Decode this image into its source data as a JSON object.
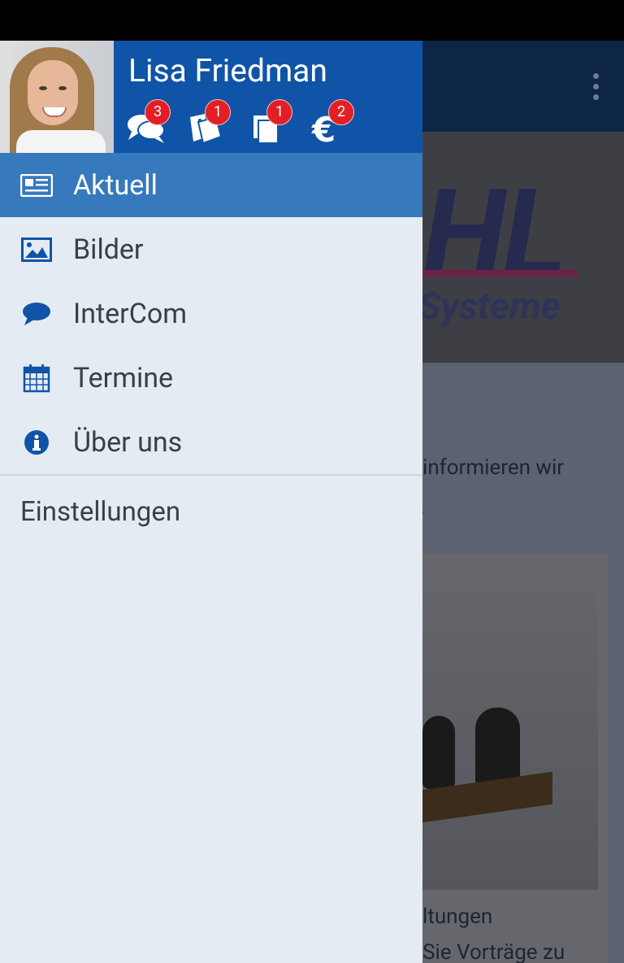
{
  "user": {
    "name": "Lisa Friedman"
  },
  "header_icons": [
    {
      "name": "chat-icon",
      "badge": "3"
    },
    {
      "name": "tickets-icon",
      "badge": "1"
    },
    {
      "name": "documents-icon",
      "badge": "1"
    },
    {
      "name": "euro-icon",
      "badge": "2"
    }
  ],
  "menu": {
    "items": [
      {
        "label": "Aktuell",
        "icon": "newspaper-icon",
        "active": true
      },
      {
        "label": "Bilder",
        "icon": "image-icon",
        "active": false
      },
      {
        "label": "InterCom",
        "icon": "speech-bubble-icon",
        "active": false
      },
      {
        "label": "Termine",
        "icon": "calendar-icon",
        "active": false
      },
      {
        "label": "Über uns",
        "icon": "info-icon",
        "active": false
      }
    ],
    "settings_label": "Einstellungen"
  },
  "background": {
    "logo_text": "HL",
    "logo_subtitle": "Systeme",
    "text_line1": "informieren wir",
    "text_line2": ".",
    "caption_line1": "ltungen",
    "caption_line2": "Sie Vorträge zu"
  },
  "colors": {
    "drawer_header": "#0f54a7",
    "active_item": "#3779bd",
    "drawer_bg": "#e4ebf3",
    "badge": "#e11f25",
    "icon": "#0f54a7"
  }
}
